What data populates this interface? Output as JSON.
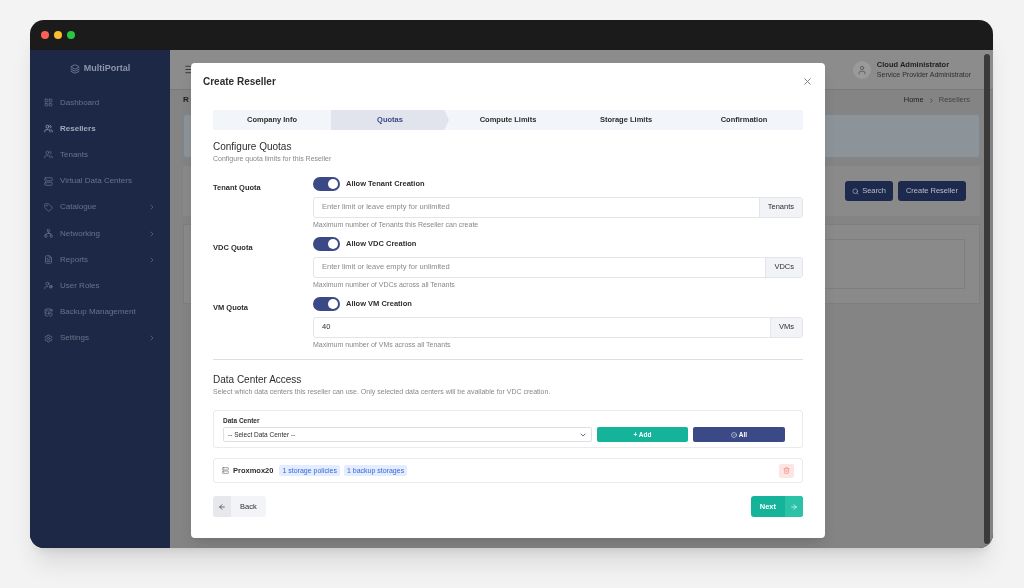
{
  "sidebar": {
    "logo": "MultiPortal",
    "items": [
      {
        "label": "Dashboard",
        "selected": false,
        "submenu": false
      },
      {
        "label": "Resellers",
        "selected": true,
        "submenu": false
      },
      {
        "label": "Tenants",
        "selected": false,
        "submenu": false
      },
      {
        "label": "Virtual Data Centers",
        "selected": false,
        "submenu": false
      },
      {
        "label": "Catalogue",
        "selected": false,
        "submenu": true
      },
      {
        "label": "Networking",
        "selected": false,
        "submenu": true
      },
      {
        "label": "Reports",
        "selected": false,
        "submenu": true
      },
      {
        "label": "User Roles",
        "selected": false,
        "submenu": false
      },
      {
        "label": "Backup Management",
        "selected": false,
        "submenu": false
      },
      {
        "label": "Settings",
        "selected": false,
        "submenu": true
      }
    ]
  },
  "topbar": {
    "user_name": "Cloud Administrator",
    "user_role": "Service Provider Administrator"
  },
  "page": {
    "heading": "R",
    "breadcrumb": [
      "Home",
      "Resellers"
    ],
    "search_button": "Search",
    "create_button": "Create Reseller"
  },
  "modal": {
    "title": "Create Reseller",
    "steps": [
      {
        "label": "Company Info",
        "selected": false
      },
      {
        "label": "Quotas",
        "selected": true
      },
      {
        "label": "Compute Limits",
        "selected": false
      },
      {
        "label": "Storage Limits",
        "selected": false
      },
      {
        "label": "Confirmation",
        "selected": false
      }
    ],
    "section_title": "Configure Quotas",
    "section_subtitle": "Configure quota limits for this Reseller",
    "quotas": [
      {
        "label": "Tenant Quota",
        "toggle_label": "Allow Tenant Creation",
        "on": true,
        "placeholder": "Enter limit or leave empty for unlimited",
        "unit": "Tenants",
        "hint": "Maximum number of Tenants this Reseller can create"
      },
      {
        "label": "VDC Quota",
        "toggle_label": "Allow VDC Creation",
        "on": true,
        "placeholder": "Enter limit or leave empty for unlimited",
        "unit": "VDCs",
        "hint": "Maximum number of VDCs across all Tenants"
      },
      {
        "label": "VM Quota",
        "toggle_label": "Allow VM Creation",
        "on": true,
        "value": "40",
        "unit": "VMs",
        "hint": "Maximum number of VMs across all Tenants"
      }
    ],
    "dc_title": "Data Center Access",
    "dc_description": "Select which data centers this reseller can use. Only selected data centers will be available for VDC creation.",
    "dc_field_label": "Data Center",
    "dc_select": "-- Select Data Center --",
    "add_button": "+ Add",
    "all_button": "All",
    "data_centers": [
      {
        "name": "Proxmox20",
        "badges": [
          "1 storage policies",
          "1 backup storages"
        ]
      }
    ],
    "back_button": "Back",
    "next_button": "Next"
  }
}
